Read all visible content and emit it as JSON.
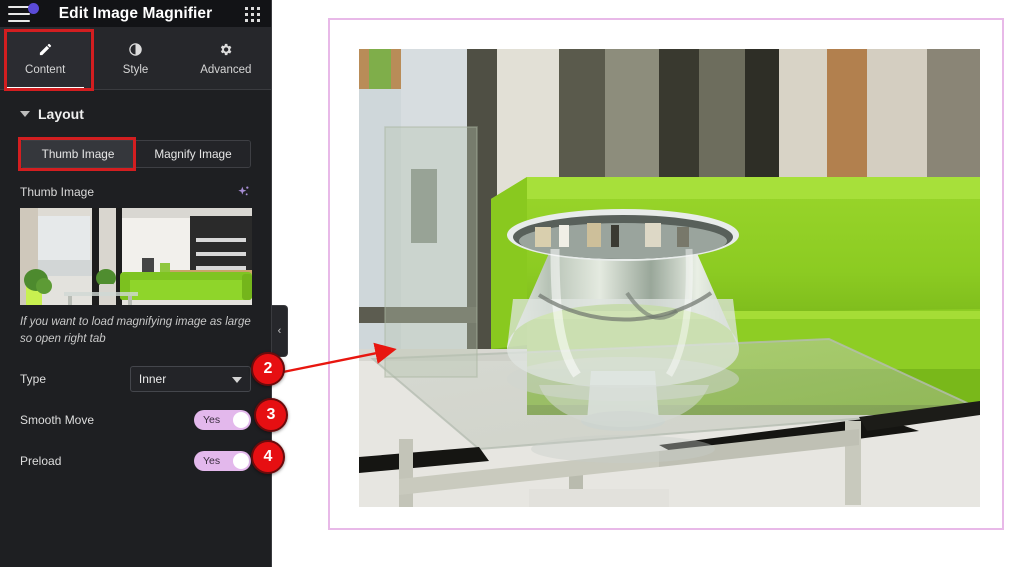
{
  "topbar": {
    "title": "Edit Image Magnifier",
    "menu_icon": "hamburger-icon",
    "apps_icon": "apps-grid-icon",
    "notification_dot": "#5b4bd8"
  },
  "tabs": [
    {
      "label": "Content",
      "icon": "pencil-icon",
      "active": true
    },
    {
      "label": "Style",
      "icon": "contrast-icon",
      "active": false
    },
    {
      "label": "Advanced",
      "icon": "gear-icon",
      "active": false
    }
  ],
  "panel": {
    "section_title": "Layout",
    "segmented": {
      "options": [
        {
          "label": "Thumb Image",
          "active": true
        },
        {
          "label": "Magnify Image",
          "active": false
        }
      ]
    },
    "thumb_field_label": "Thumb Image",
    "sparkle_icon": "ai-sparkle-icon",
    "hint_text": "If you want to load magnifying image as large so open right tab",
    "controls": [
      {
        "name": "type",
        "label": "Type",
        "kind": "select",
        "value": "Inner"
      },
      {
        "name": "smooth_move",
        "label": "Smooth Move",
        "kind": "toggle",
        "value": "Yes"
      },
      {
        "name": "preload",
        "label": "Preload",
        "kind": "toggle",
        "value": "Yes"
      }
    ],
    "collapse_handle_icon": "chevron-left-icon"
  },
  "markers": [
    {
      "id": "2",
      "label": "2"
    },
    {
      "id": "3",
      "label": "3"
    },
    {
      "id": "4",
      "label": "4"
    }
  ],
  "colors": {
    "marker_red": "#e60f12",
    "highlight_red": "#d31e20",
    "frame_pink": "#e8b9e8",
    "toggle_on": "#e3b8ec",
    "panel_bg": "#1e1f22",
    "topbar_bg": "#121316"
  },
  "preview": {
    "frame_label": "magnified-image-preview",
    "image_alt": "green-sofa-living-room-magnified"
  }
}
